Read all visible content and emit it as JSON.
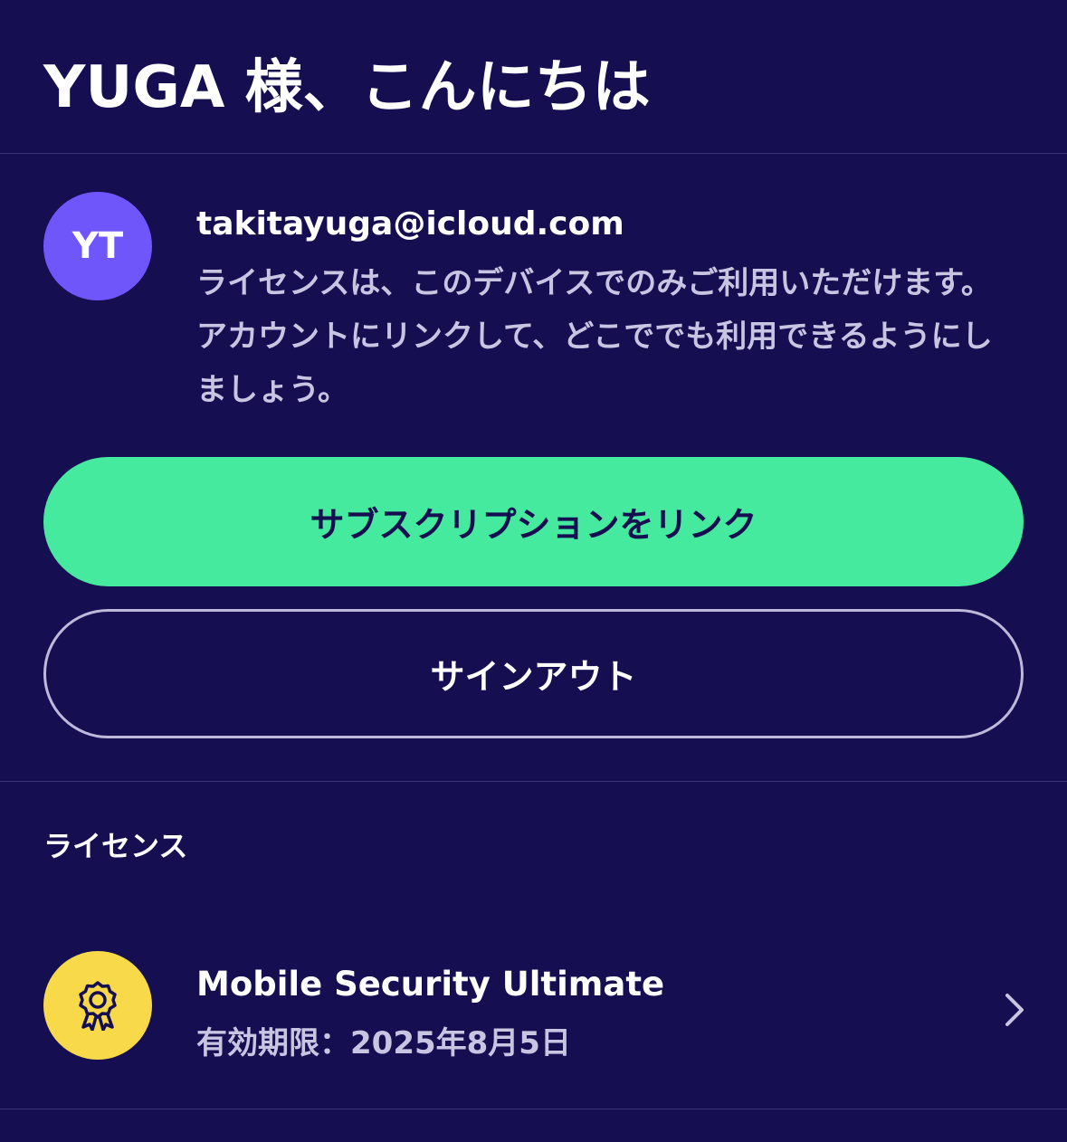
{
  "header": {
    "greeting": "YUGA 様、こんにちは"
  },
  "account": {
    "initials": "YT",
    "email": "takitayuga@icloud.com",
    "message": "ライセンスは、このデバイスでのみご利用いただけます。アカウントにリンクして、どこででも利用できるようにしましょう。",
    "link_button": "サブスクリプションをリンク",
    "signout_button": "サインアウト"
  },
  "licenses": {
    "section_title": "ライセンス",
    "items": [
      {
        "name": "Mobile Security Ultimate",
        "expiry": "有効期限：2025年8月5日",
        "icon": "award-ribbon-icon"
      }
    ]
  },
  "colors": {
    "background": "#150f52",
    "avatar": "#6f56fb",
    "primary_button": "#46ea9e",
    "badge": "#f8d94a",
    "muted_text": "#c8c5e2"
  }
}
